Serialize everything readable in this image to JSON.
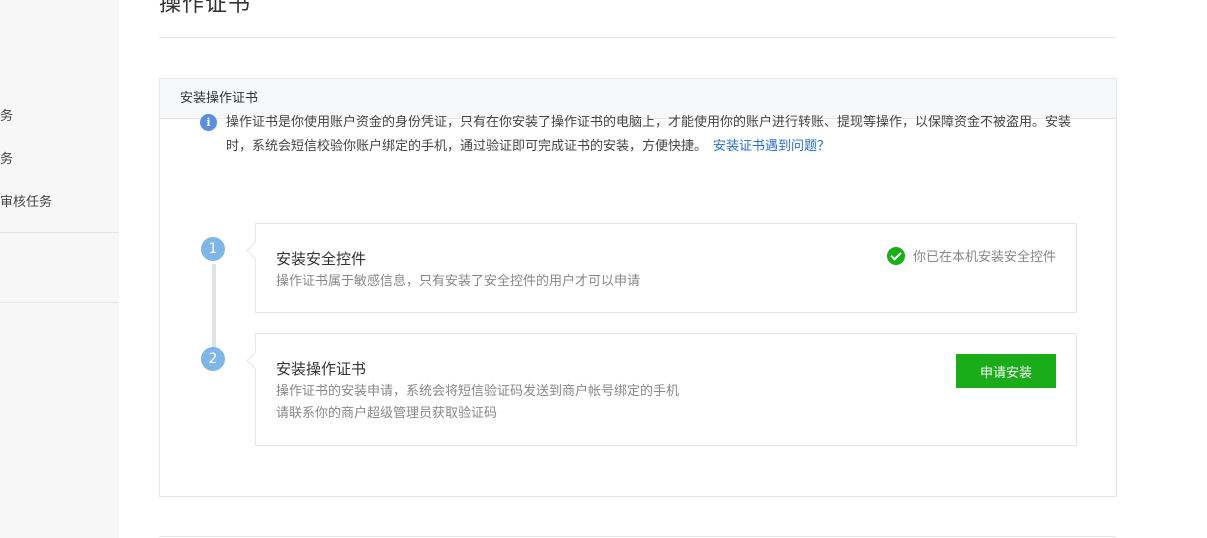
{
  "sidebar": {
    "items": [
      {
        "label": "务"
      },
      {
        "label": "务"
      },
      {
        "label": "审核任务"
      }
    ]
  },
  "page_title": "操作证书",
  "panel": {
    "title": "安装操作证书",
    "info_icon": "info-icon",
    "info_text": "操作证书是你使用账户资金的身份凭证，只有在你安装了操作证书的电脑上，才能使用你的账户进行转账、提现等操作，以保障资金不被盗用。安装时，系统会短信校验你账户绑定的手机，通过验证即可完成证书的安装，方便快捷。",
    "info_link": "安装证书遇到问题？"
  },
  "steps": [
    {
      "number": "1",
      "title": "安装安全控件",
      "desc": "操作证书属于敏感信息，只有安装了安全控件的用户才可以申请",
      "status_icon": "check-circle-icon",
      "status_text": "你已在本机安装安全控件"
    },
    {
      "number": "2",
      "title": "安装操作证书",
      "desc_line1": "操作证书的安装申请，系统会将短信验证码发送到商户帐号绑定的手机",
      "desc_line2": "请联系你的商户超级管理员获取验证码",
      "button_label": "申请安装"
    }
  ],
  "colors": {
    "accent_green": "#1aad19",
    "link_blue": "#2a6ec9",
    "step_badge": "#7fb6e8",
    "info_blue": "#5b8fde"
  }
}
